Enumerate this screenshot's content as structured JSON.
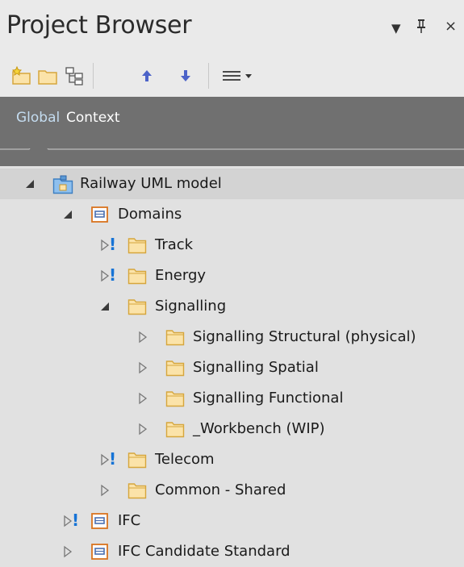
{
  "panel": {
    "title": "Project Browser",
    "dropdown_glyph": "▼",
    "pin_glyph": "ᵻ",
    "close_glyph": "×"
  },
  "toolbar": {
    "icons": [
      "new-package-icon",
      "new-folder-icon",
      "new-diagram-icon",
      "move-up-icon",
      "move-down-icon",
      "menu-icon"
    ]
  },
  "tabs": [
    {
      "label": "Global",
      "active": true
    },
    {
      "label": "Context",
      "active": false
    }
  ],
  "tree": [
    {
      "label": "Railway UML model",
      "icon": "model-root-icon",
      "expanded": true,
      "level": 0
    },
    {
      "label": "Domains",
      "icon": "package-icon",
      "expanded": true,
      "level": 1
    },
    {
      "label": "Track",
      "icon": "folder-icon",
      "expanded": false,
      "flag": "!",
      "level": 2
    },
    {
      "label": "Energy",
      "icon": "folder-icon",
      "expanded": false,
      "flag": "!",
      "level": 2
    },
    {
      "label": "Signalling",
      "icon": "folder-icon",
      "expanded": true,
      "level": 2
    },
    {
      "label": "Signalling Structural (physical)",
      "icon": "folder-icon",
      "expanded": false,
      "level": 3
    },
    {
      "label": "Signalling Spatial",
      "icon": "folder-icon",
      "expanded": false,
      "level": 3
    },
    {
      "label": "Signalling Functional",
      "icon": "folder-icon",
      "expanded": false,
      "level": 3
    },
    {
      "label": "_Workbench (WIP)",
      "icon": "folder-icon",
      "expanded": false,
      "level": 3
    },
    {
      "label": "Telecom",
      "icon": "folder-icon",
      "expanded": false,
      "flag": "!",
      "level": 2
    },
    {
      "label": "Common - Shared",
      "icon": "folder-icon",
      "expanded": false,
      "level": 2
    },
    {
      "label": "IFC",
      "icon": "package-icon",
      "expanded": false,
      "flag": "!",
      "level": 1
    },
    {
      "label": "IFC Candidate Standard",
      "icon": "package-icon",
      "expanded": false,
      "level": 1
    }
  ],
  "colors": {
    "tab_bar": "#707070",
    "active_tab": "#c4dcf0",
    "folder_fill": "#fbe3a9",
    "folder_stroke": "#d6a63c",
    "package_fill": "#ffffff",
    "package_stroke": "#d9731f",
    "flag": "#1673d6",
    "arrow": "#4c63c8"
  }
}
